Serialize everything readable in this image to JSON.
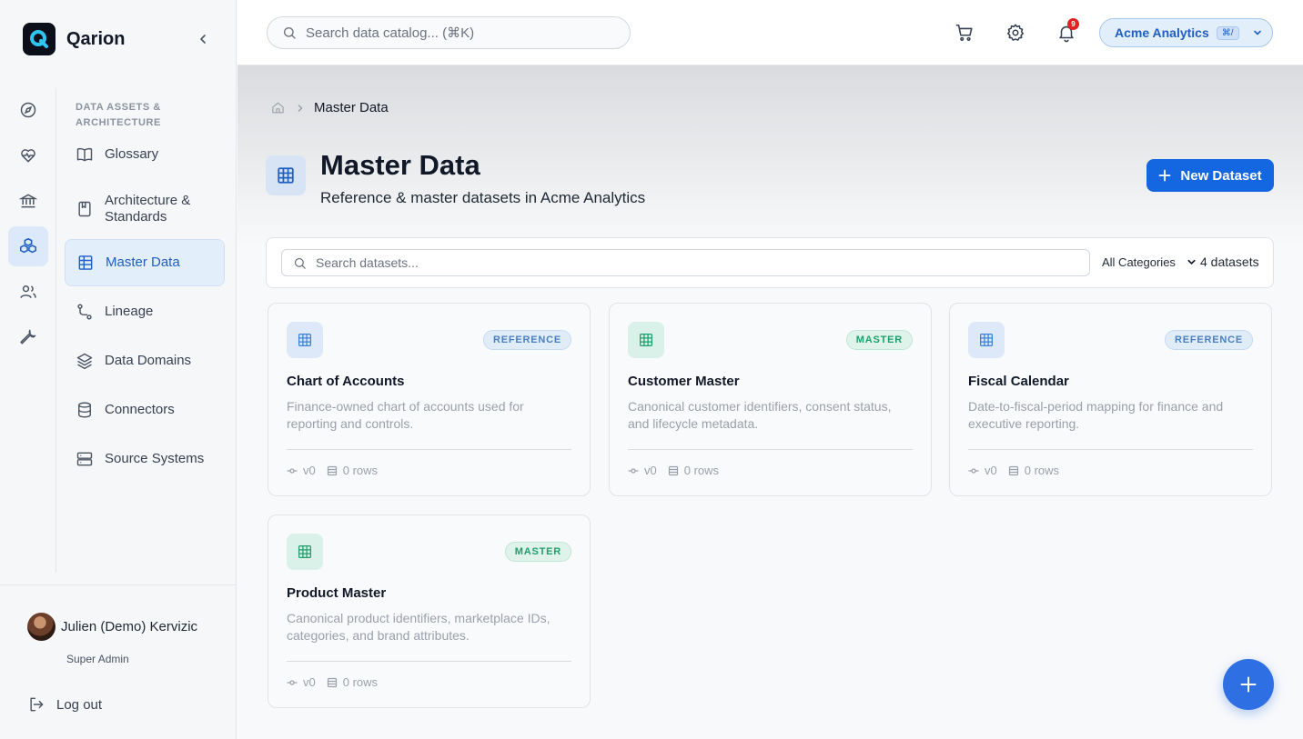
{
  "app": {
    "name": "Qarion"
  },
  "colors": {
    "accent": "#1467e0",
    "master": "#1f9e6e",
    "reference": "#4a7fc0"
  },
  "rail": {
    "items": [
      {
        "name": "compass-icon"
      },
      {
        "name": "heart-pulse-icon"
      },
      {
        "name": "bank-icon"
      },
      {
        "name": "cubes-icon",
        "active": true
      },
      {
        "name": "users-icon"
      },
      {
        "name": "wrench-icon"
      }
    ]
  },
  "sidebar": {
    "section_title": "DATA ASSETS & ARCHITECTURE",
    "items": [
      {
        "label": "Glossary",
        "icon": "book-icon"
      },
      {
        "label": "Architecture & Standards",
        "icon": "bookmark-book-icon"
      },
      {
        "label": "Master Data",
        "icon": "table-icon",
        "active": true
      },
      {
        "label": "Lineage",
        "icon": "lineage-icon"
      },
      {
        "label": "Data Domains",
        "icon": "layers-icon"
      },
      {
        "label": "Connectors",
        "icon": "database-icon"
      },
      {
        "label": "Source Systems",
        "icon": "server-icon"
      }
    ]
  },
  "user": {
    "name": "Julien (Demo) Kervizic",
    "role": "Super Admin",
    "logout_label": "Log out"
  },
  "topbar": {
    "search_placeholder": "Search data catalog... (⌘K)",
    "notifications_count": "9",
    "org_name": "Acme Analytics",
    "org_shortcut": "⌘/"
  },
  "breadcrumb": {
    "current": "Master Data"
  },
  "page": {
    "title": "Master Data",
    "subtitle": "Reference & master datasets in Acme Analytics",
    "new_button": "New Dataset"
  },
  "filters": {
    "search_placeholder": "Search datasets...",
    "category_selected": "All Categories",
    "count_label": "4 datasets"
  },
  "datasets": [
    {
      "title": "Chart of Accounts",
      "badge": "REFERENCE",
      "kind": "reference",
      "description": "Finance-owned chart of accounts used for reporting and controls.",
      "version": "v0",
      "rows": "0 rows"
    },
    {
      "title": "Customer Master",
      "badge": "MASTER",
      "kind": "master",
      "description": "Canonical customer identifiers, consent status, and lifecycle metadata.",
      "version": "v0",
      "rows": "0 rows"
    },
    {
      "title": "Fiscal Calendar",
      "badge": "REFERENCE",
      "kind": "reference",
      "description": "Date-to-fiscal-period mapping for finance and executive reporting.",
      "version": "v0",
      "rows": "0 rows"
    },
    {
      "title": "Product Master",
      "badge": "MASTER",
      "kind": "master",
      "description": "Canonical product identifiers, marketplace IDs, categories, and brand attributes.",
      "version": "v0",
      "rows": "0 rows"
    }
  ]
}
